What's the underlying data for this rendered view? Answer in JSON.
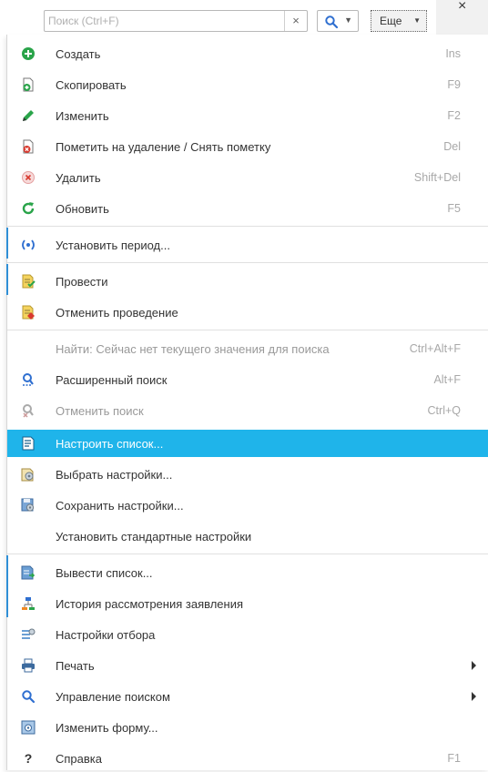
{
  "toolbar": {
    "search_placeholder": "Поиск (Ctrl+F)",
    "clear_symbol": "×",
    "more_label": "Еще",
    "close_symbol": "×"
  },
  "menu": {
    "items": [
      {
        "label": "Создать",
        "shortcut": "Ins",
        "icon": "plus-circle-icon"
      },
      {
        "label": "Скопировать",
        "shortcut": "F9",
        "icon": "copy-document-icon"
      },
      {
        "label": "Изменить",
        "shortcut": "F2",
        "icon": "pencil-icon"
      },
      {
        "label": "Пометить на удаление / Снять пометку",
        "shortcut": "Del",
        "icon": "mark-delete-icon"
      },
      {
        "label": "Удалить",
        "shortcut": "Shift+Del",
        "icon": "delete-x-icon"
      },
      {
        "label": "Обновить",
        "shortcut": "F5",
        "icon": "refresh-icon"
      },
      {
        "label": "Установить период...",
        "shortcut": "",
        "icon": "period-icon"
      },
      {
        "label": "Провести",
        "shortcut": "",
        "icon": "post-document-icon"
      },
      {
        "label": "Отменить проведение",
        "shortcut": "",
        "icon": "unpost-document-icon"
      },
      {
        "label": "Найти: Сейчас нет текущего значения для поиска",
        "shortcut": "Ctrl+Alt+F",
        "icon": ""
      },
      {
        "label": "Расширенный поиск",
        "shortcut": "Alt+F",
        "icon": "advanced-search-icon"
      },
      {
        "label": "Отменить поиск",
        "shortcut": "Ctrl+Q",
        "icon": "cancel-search-icon"
      },
      {
        "label": "Настроить список...",
        "shortcut": "",
        "icon": "list-settings-icon"
      },
      {
        "label": "Выбрать настройки...",
        "shortcut": "",
        "icon": "choose-settings-icon"
      },
      {
        "label": "Сохранить настройки...",
        "shortcut": "",
        "icon": "save-settings-icon"
      },
      {
        "label": "Установить стандартные настройки",
        "shortcut": "",
        "icon": ""
      },
      {
        "label": "Вывести список...",
        "shortcut": "",
        "icon": "output-list-icon"
      },
      {
        "label": "История рассмотрения заявления",
        "shortcut": "",
        "icon": "history-icon"
      },
      {
        "label": "Настройки отбора",
        "shortcut": "",
        "icon": "filter-settings-icon"
      },
      {
        "label": "Печать",
        "shortcut": "",
        "icon": "printer-icon"
      },
      {
        "label": "Управление поиском",
        "shortcut": "",
        "icon": "search-control-icon"
      },
      {
        "label": "Изменить форму...",
        "shortcut": "",
        "icon": "change-form-icon"
      },
      {
        "label": "Справка",
        "shortcut": "F1",
        "icon": "help-icon"
      }
    ]
  },
  "colors": {
    "highlight": "#1fb4ea",
    "accent_green": "#2aa44a",
    "accent_blue": "#2f6fd0",
    "accent_red": "#d83a2f"
  }
}
